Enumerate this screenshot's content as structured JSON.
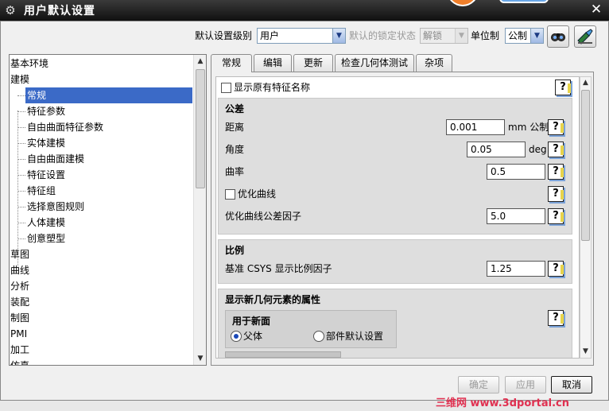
{
  "window": {
    "title": "用户默认设置",
    "close": "✕",
    "gear": "⚙"
  },
  "top": {
    "level_label": "默认设置级别",
    "level_value": "用户",
    "lock_label": "默认的锁定状态",
    "lock_value": "解锁",
    "unit_label": "单位制",
    "unit_value": "公制"
  },
  "tree": {
    "items": [
      {
        "label": "基本环境"
      },
      {
        "label": "建模"
      },
      {
        "label": "常规"
      },
      {
        "label": "特征参数"
      },
      {
        "label": "自由曲面特征参数"
      },
      {
        "label": "实体建模"
      },
      {
        "label": "自由曲面建模"
      },
      {
        "label": "特征设置"
      },
      {
        "label": "特征组"
      },
      {
        "label": "选择意图规则"
      },
      {
        "label": "人体建模"
      },
      {
        "label": "创意塑型"
      },
      {
        "label": "草图"
      },
      {
        "label": "曲线"
      },
      {
        "label": "分析"
      },
      {
        "label": "装配"
      },
      {
        "label": "制图"
      },
      {
        "label": "PMI"
      },
      {
        "label": "加工"
      },
      {
        "label": "仿真"
      }
    ]
  },
  "tabs": [
    {
      "label": "常规"
    },
    {
      "label": "编辑"
    },
    {
      "label": "更新"
    },
    {
      "label": "检查几何体测试"
    },
    {
      "label": "杂项"
    }
  ],
  "content": {
    "show_original_name": "显示原有特征名称",
    "tolerance": {
      "title": "公差",
      "distance_label": "距离",
      "distance_value": "0.001",
      "distance_unit": "mm 公制",
      "angle_label": "角度",
      "angle_value": "0.05",
      "angle_unit": "deg",
      "curvature_label": "曲率",
      "curvature_value": "0.5",
      "optimize_curve_label": "优化曲线",
      "optimize_factor_label": "优化曲线公差因子",
      "optimize_factor_value": "5.0"
    },
    "scale": {
      "title": "比例",
      "csys_label": "基准 CSYS 显示比例因子",
      "csys_value": "1.25"
    },
    "new_geometry": {
      "title": "显示新几何元素的属性",
      "for_new_face": "用于新面",
      "parent_option": "父体",
      "part_default_option": "部件默认设置"
    },
    "help_glyph": "?"
  },
  "buttons": {
    "ok": "确定",
    "apply": "应用",
    "cancel": "取消"
  },
  "watermark": "三维网 www.3dportal.cn"
}
